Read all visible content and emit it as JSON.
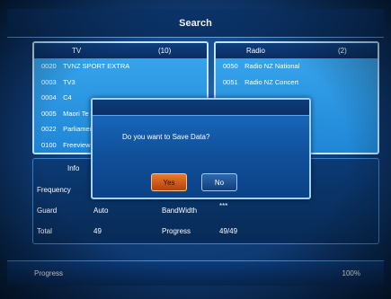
{
  "title": "Search",
  "tv_panel": {
    "label": "TV",
    "count": "(10)",
    "channels": [
      {
        "num": "0020",
        "name": "TVNZ SPORT EXTRA"
      },
      {
        "num": "0003",
        "name": "TV3"
      },
      {
        "num": "0004",
        "name": "C4"
      },
      {
        "num": "0005",
        "name": "Maori Te"
      },
      {
        "num": "0022",
        "name": "Parliamen"
      },
      {
        "num": "0100",
        "name": "Freeview"
      }
    ]
  },
  "radio_panel": {
    "label": "Radio",
    "count": "(2)",
    "channels": [
      {
        "num": "0050",
        "name": "Radio NZ National"
      },
      {
        "num": "0051",
        "name": "Radio NZ Concert"
      }
    ]
  },
  "info": {
    "title": "Info",
    "frequency_label": "Frequency",
    "guard_label": "Guard",
    "guard_value": "Auto",
    "bandwidth_label": "BandWidth",
    "bandwidth_value": "***",
    "total_label": "Total",
    "total_value": "49",
    "progress_label": "Progress",
    "progress_value": "49/49"
  },
  "bottom": {
    "label": "Progress",
    "value": "100%",
    "percent": 100
  },
  "dialog": {
    "message": "Do you want to Save Data?",
    "yes_label": "Yes",
    "no_label": "No"
  },
  "colors": {
    "background": "#11407e",
    "panel": "#2b96e2",
    "yes_button": "#d85e1e",
    "no_button": "#1f5396"
  }
}
